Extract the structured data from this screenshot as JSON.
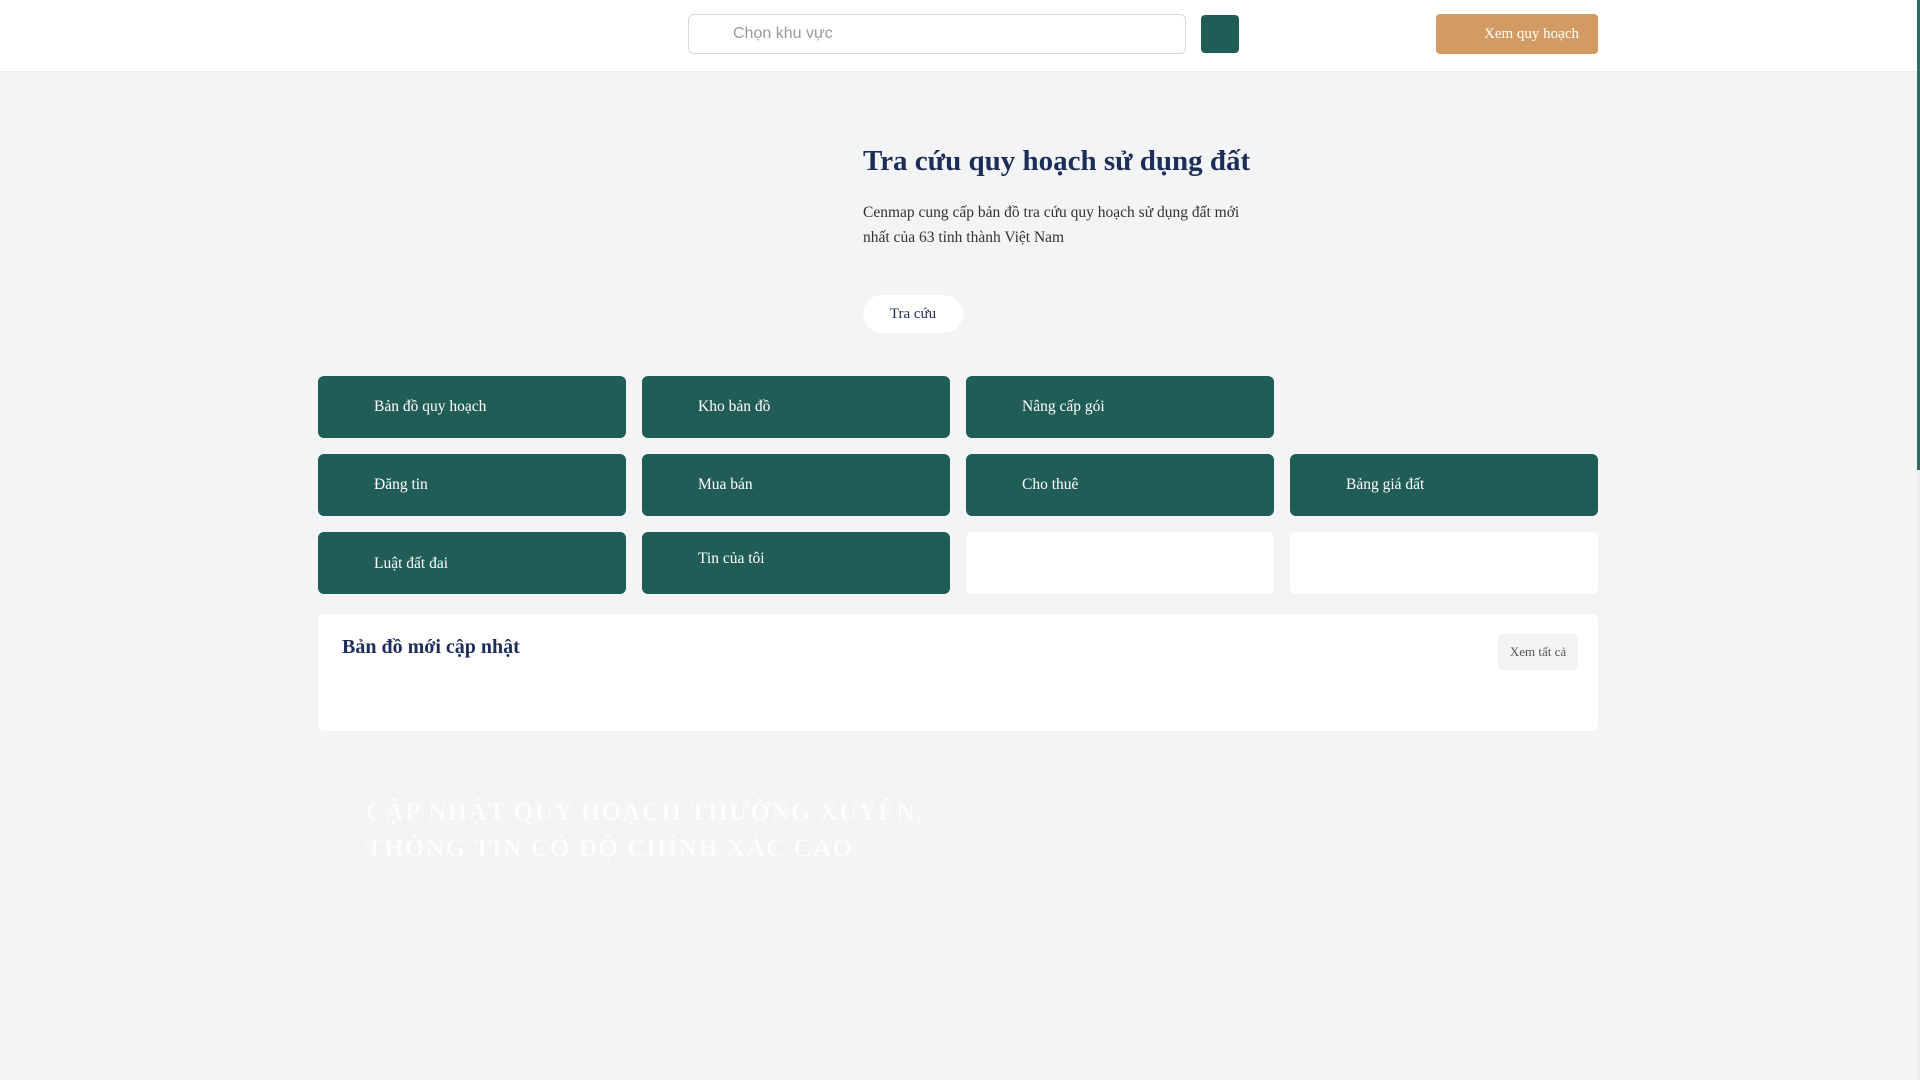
{
  "colors": {
    "primary": "#215d57",
    "accent": "#d29b63",
    "heading": "#1c2d59"
  },
  "header": {
    "search_placeholder": "Chọn khu vực",
    "search_icon": "search-icon",
    "search_button_icon": "search-icon",
    "plan_button_label": "Xem quy hoạch",
    "plan_button_icon": "map-pin-icon"
  },
  "hero": {
    "title": "Tra cứu quy hoạch sử dụng đất",
    "description": "Cenmap cung cấp bản đồ tra cứu quy hoạch sử dụng đất mới nhất của 63 tỉnh thành Việt Nam",
    "lookup_button": "Tra cứu"
  },
  "tiles": [
    {
      "label": "Bản đồ quy hoạch"
    },
    {
      "label": "Kho bản đồ"
    },
    {
      "label": "Nâng cấp gói"
    },
    {
      "label": "Đăng tin"
    },
    {
      "label": "Mua bán"
    },
    {
      "label": "Cho thuê"
    },
    {
      "label": "Bảng giá đất"
    },
    {
      "label": "Luật đất đai"
    },
    {
      "label": "Tin của tôi"
    }
  ],
  "updates": {
    "title": "Bản đồ mới cập nhật",
    "see_all": "Xem tất cả"
  },
  "banner": {
    "line1": "CẬP NHẬT QUY HOẠCH THƯỜNG XUYÊN,",
    "line2": "THÔNG TIN CÓ ĐỘ CHÍNH XÁC CAO"
  }
}
